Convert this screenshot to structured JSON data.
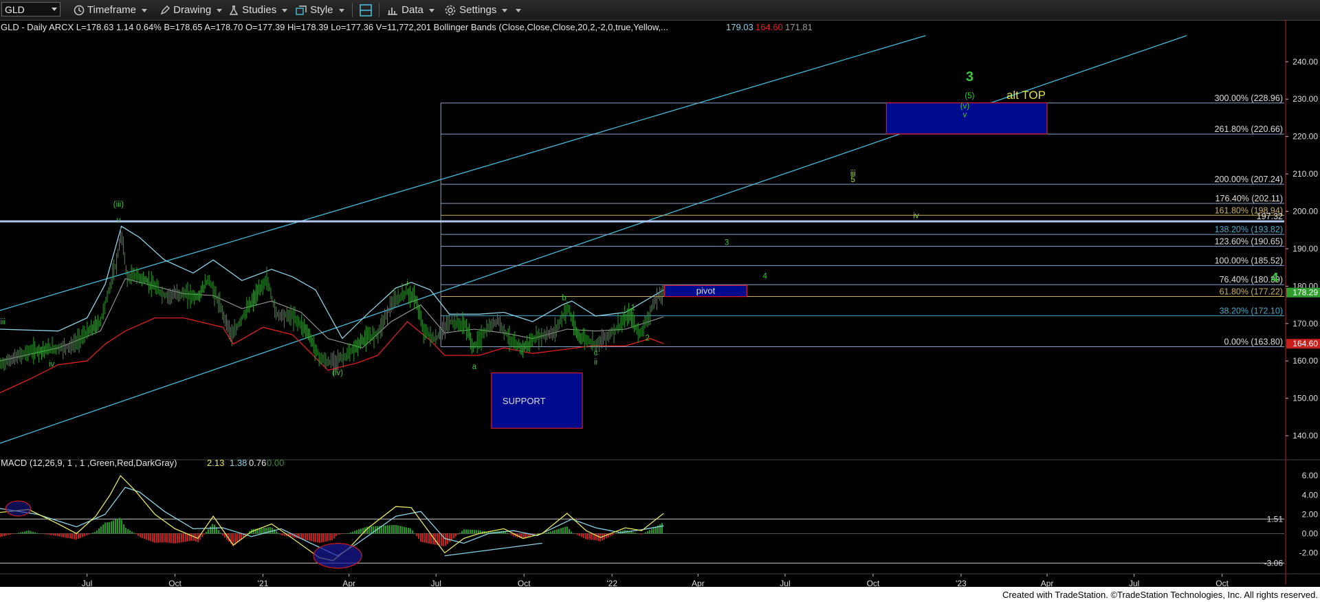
{
  "toolbar": {
    "symbol": "GLD",
    "timeframe": "Timeframe",
    "drawing": "Drawing",
    "studies": "Studies",
    "style": "Style",
    "data": "Data",
    "settings": "Settings"
  },
  "header": {
    "main": "GLD - Daily  ARCX  L=178.63  1.14  0.64%  B=178.65  A=178.70  O=177.39  Hi=178.39  Lo=177.36  V=11,772,201  Bollinger Bands (Close,Close,Close,20,2,-2,0,true,Yellow,...",
    "bb_upper": "179.03",
    "bb_lower": "164.60",
    "bb_mid": "171.81",
    "macd": "MACD (12,26,9, 1 , 1 ,Green,Red,DarkGray)",
    "macd_v1": "2.13",
    "macd_v2": "1.38",
    "macd_v3": "0.76",
    "macd_v4": "0.00"
  },
  "footer": "Created with TradeStation. ©TradeStation Technologies, Inc. All rights reserved.",
  "colors": {
    "price_bars": "#2e9e2e",
    "bb_upper": "#8fd4e8",
    "bb_lower": "#e02020",
    "bb_mid": "#9a9a9a",
    "channel": "#48bcd8",
    "fib": "#8aa2c8",
    "box": "#000a8c",
    "box_border": "#d81c2c",
    "wave": "#3cc83c",
    "wave_yellow": "#e0e040",
    "macd_line": "#e8e860",
    "signal_line": "#8fd4e8"
  },
  "chart_data": [
    {
      "type": "line",
      "title": "GLD - Daily",
      "x_ticks": [
        "Jul",
        "Oct",
        "'21",
        "Apr",
        "Jul",
        "Oct",
        "'22",
        "Apr",
        "Jul",
        "Oct",
        "'23",
        "Apr",
        "Jul",
        "Oct"
      ],
      "y_ticks": [
        140,
        150,
        160,
        170,
        180,
        190,
        200,
        210,
        220,
        230,
        240
      ],
      "ylim": [
        134.5,
        247.5
      ],
      "last_price": "178.29",
      "lower_band_value": "164.60",
      "price": [
        [
          "2020-04-01",
          159.0
        ],
        [
          "2020-05-01",
          162.5
        ],
        [
          "2020-06-01",
          163.5
        ],
        [
          "2020-06-15",
          164.0
        ],
        [
          "2020-07-01",
          167.5
        ],
        [
          "2020-07-15",
          170.5
        ],
        [
          "2020-07-25",
          180.0
        ],
        [
          "2020-08-01",
          186.5
        ],
        [
          "2020-08-06",
          194.5
        ],
        [
          "2020-08-12",
          182.0
        ],
        [
          "2020-08-20",
          183.0
        ],
        [
          "2020-09-01",
          181.5
        ],
        [
          "2020-09-20",
          177.5
        ],
        [
          "2020-10-10",
          178.0
        ],
        [
          "2020-10-25",
          177.0
        ],
        [
          "2020-11-05",
          182.0
        ],
        [
          "2020-11-15",
          176.0
        ],
        [
          "2020-11-30",
          166.5
        ],
        [
          "2020-12-10",
          171.5
        ],
        [
          "2021-01-05",
          182.0
        ],
        [
          "2021-01-15",
          172.5
        ],
        [
          "2021-02-01",
          172.0
        ],
        [
          "2021-02-15",
          168.5
        ],
        [
          "2021-03-01",
          161.0
        ],
        [
          "2021-03-10",
          159.5
        ],
        [
          "2021-03-31",
          161.5
        ],
        [
          "2021-04-15",
          165.5
        ],
        [
          "2021-05-01",
          167.5
        ],
        [
          "2021-05-15",
          175.0
        ],
        [
          "2021-05-31",
          178.5
        ],
        [
          "2021-06-10",
          176.5
        ],
        [
          "2021-06-17",
          168.5
        ],
        [
          "2021-06-30",
          165.5
        ],
        [
          "2021-07-15",
          170.5
        ],
        [
          "2021-08-01",
          169.5
        ],
        [
          "2021-08-09",
          163.5
        ],
        [
          "2021-08-20",
          167.5
        ],
        [
          "2021-09-03",
          171.0
        ],
        [
          "2021-09-20",
          164.5
        ],
        [
          "2021-09-30",
          163.5
        ],
        [
          "2021-10-15",
          166.5
        ],
        [
          "2021-11-01",
          167.5
        ],
        [
          "2021-11-16",
          174.5
        ],
        [
          "2021-11-25",
          167.0
        ],
        [
          "2021-12-15",
          164.5
        ],
        [
          "2022-01-03",
          168.0
        ],
        [
          "2022-01-20",
          172.5
        ],
        [
          "2022-01-28",
          167.5
        ],
        [
          "2022-02-01",
          168.0
        ],
        [
          "2022-02-11",
          173.5
        ],
        [
          "2022-02-17",
          177.0
        ],
        [
          "2022-02-24",
          178.3
        ]
      ],
      "bb_upper": [
        [
          "2020-04-01",
          168.5
        ],
        [
          "2020-06-01",
          168.0
        ],
        [
          "2020-07-01",
          171.5
        ],
        [
          "2020-07-20",
          180.5
        ],
        [
          "2020-08-06",
          196.0
        ],
        [
          "2020-08-25",
          193.0
        ],
        [
          "2020-09-20",
          187.0
        ],
        [
          "2020-10-20",
          183.5
        ],
        [
          "2020-11-10",
          187.0
        ],
        [
          "2020-12-10",
          181.5
        ],
        [
          "2021-01-10",
          184.5
        ],
        [
          "2021-02-01",
          182.5
        ],
        [
          "2021-02-25",
          179.0
        ],
        [
          "2021-03-25",
          166.0
        ],
        [
          "2021-04-20",
          172.5
        ],
        [
          "2021-05-20",
          179.5
        ],
        [
          "2021-06-05",
          181.0
        ],
        [
          "2021-06-25",
          179.0
        ],
        [
          "2021-07-15",
          172.5
        ],
        [
          "2021-08-15",
          172.5
        ],
        [
          "2021-09-10",
          173.0
        ],
        [
          "2021-10-10",
          170.5
        ],
        [
          "2021-11-10",
          175.0
        ],
        [
          "2021-11-20",
          176.0
        ],
        [
          "2021-12-15",
          172.0
        ],
        [
          "2022-01-15",
          173.0
        ],
        [
          "2022-02-24",
          179.0
        ]
      ],
      "bb_lower": [
        [
          "2020-04-01",
          151.5
        ],
        [
          "2020-05-01",
          155.0
        ],
        [
          "2020-06-01",
          159.0
        ],
        [
          "2020-07-01",
          160.0
        ],
        [
          "2020-07-20",
          164.5
        ],
        [
          "2020-08-10",
          168.0
        ],
        [
          "2020-09-10",
          171.5
        ],
        [
          "2020-10-10",
          171.5
        ],
        [
          "2020-11-20",
          169.0
        ],
        [
          "2020-12-01",
          164.5
        ],
        [
          "2021-01-01",
          169.0
        ],
        [
          "2021-02-01",
          167.0
        ],
        [
          "2021-03-10",
          157.5
        ],
        [
          "2021-04-10",
          159.5
        ],
        [
          "2021-05-01",
          161.5
        ],
        [
          "2021-06-01",
          170.5
        ],
        [
          "2021-06-25",
          165.5
        ],
        [
          "2021-07-10",
          161.5
        ],
        [
          "2021-08-15",
          161.5
        ],
        [
          "2021-09-10",
          163.5
        ],
        [
          "2021-10-10",
          162.0
        ],
        [
          "2021-11-10",
          163.0
        ],
        [
          "2021-12-10",
          164.0
        ],
        [
          "2022-01-15",
          164.0
        ],
        [
          "2022-02-10",
          166.0
        ],
        [
          "2022-02-24",
          164.6
        ]
      ],
      "bb_mid": [
        [
          "2020-04-01",
          160.0
        ],
        [
          "2020-06-01",
          163.5
        ],
        [
          "2020-07-15",
          168.0
        ],
        [
          "2020-08-10",
          182.0
        ],
        [
          "2020-09-10",
          180.0
        ],
        [
          "2020-10-10",
          178.0
        ],
        [
          "2020-11-10",
          177.5
        ],
        [
          "2020-12-10",
          174.0
        ],
        [
          "2021-01-10",
          176.0
        ],
        [
          "2021-02-10",
          173.0
        ],
        [
          "2021-03-10",
          166.0
        ],
        [
          "2021-04-15",
          163.5
        ],
        [
          "2021-05-15",
          170.5
        ],
        [
          "2021-06-15",
          175.0
        ],
        [
          "2021-07-10",
          167.5
        ],
        [
          "2021-08-10",
          168.5
        ],
        [
          "2021-09-10",
          167.5
        ],
        [
          "2021-10-10",
          166.0
        ],
        [
          "2021-11-15",
          168.5
        ],
        [
          "2021-12-15",
          168.0
        ],
        [
          "2022-01-15",
          168.5
        ],
        [
          "2022-02-24",
          171.8
        ]
      ],
      "channel_lines": [
        {
          "from": [
            "2020-04-01",
            173.5
          ],
          "to": [
            "2022-11-25",
            247.0
          ]
        },
        {
          "from": [
            "2020-04-01",
            138.0
          ],
          "to": [
            "2023-08-25",
            247.0
          ]
        }
      ],
      "fib_anchor_date": "2021-07-06",
      "fib_levels": [
        {
          "label": "300.00% (228.96)",
          "value": 228.96
        },
        {
          "label": "261.80% (220.66)",
          "value": 220.66
        },
        {
          "label": "200.00% (207.24)",
          "value": 207.24
        },
        {
          "label": "176.40% (202.11)",
          "value": 202.11
        },
        {
          "label": "161.80% (198.94)",
          "value": 198.94
        },
        {
          "label": "138.20% (193.82)",
          "value": 193.82
        },
        {
          "label": "123.60% (190.65)",
          "value": 190.65
        },
        {
          "label": "100.00% (185.52)",
          "value": 185.52
        },
        {
          "label": "76.40% (180.39)",
          "value": 180.39
        },
        {
          "label": "61.80% (177.22)",
          "value": 177.22
        },
        {
          "label": "38.20% (172.10)",
          "value": 172.1
        },
        {
          "label": "0.00% (163.80)",
          "value": 163.8
        }
      ],
      "resistance": {
        "value": 197.32,
        "label": "197.32"
      },
      "boxes": [
        {
          "label": "pivot",
          "x0": "2022-02-25",
          "x1": "2022-05-22",
          "y0": 177.2,
          "y1": 180.2
        },
        {
          "label": "SUPPORT",
          "x0": "2021-08-28",
          "x1": "2021-12-01",
          "y0": 142.0,
          "y1": 156.8
        },
        {
          "label": "",
          "x0": "2022-10-15",
          "x1": "2023-04-01",
          "y0": 220.7,
          "y1": 229.0
        }
      ],
      "wave_labels": [
        {
          "text": "iii",
          "x": "2020-04-04",
          "y": 169.8
        },
        {
          "text": "iv",
          "x": "2020-05-25",
          "y": 158.5
        },
        {
          "text": "(iii)",
          "x": "2020-08-03",
          "y": 201.2
        },
        {
          "text": "v",
          "x": "2020-08-03",
          "y": 197.0
        },
        {
          "text": "(iv)",
          "x": "2021-03-20",
          "y": 156.2
        },
        {
          "text": "i",
          "x": "2021-06-01",
          "y": 180.2
        },
        {
          "text": "a",
          "x": "2021-08-10",
          "y": 157.8
        },
        {
          "text": "b",
          "x": "2021-11-12",
          "y": 176.2
        },
        {
          "text": "c",
          "x": "2021-12-15",
          "y": 161.5
        },
        {
          "text": "ii",
          "x": "2021-12-15",
          "y": 159.0
        },
        {
          "text": "1",
          "x": "2022-01-23",
          "y": 173.5
        },
        {
          "text": "2",
          "x": "2022-02-07",
          "y": 165.5
        },
        {
          "text": "3",
          "x": "2022-05-01",
          "y": 191.0
        },
        {
          "text": "4",
          "x": "2022-06-10",
          "y": 182.0
        },
        {
          "text": "iii",
          "x": "2022-09-10",
          "y": 209.5
        },
        {
          "text": "5",
          "x": "2022-09-10",
          "y": 207.8
        },
        {
          "text": "iv",
          "x": "2022-11-15",
          "y": 198.2
        },
        {
          "text": "3",
          "x": "2023-01-10",
          "y": 234.8
        },
        {
          "text": "(5)",
          "x": "2023-01-10",
          "y": 230.2
        },
        {
          "text": "(v)",
          "x": "2023-01-05",
          "y": 227.5
        },
        {
          "text": "v",
          "x": "2023-01-05",
          "y": 225.2
        },
        {
          "text": "alt TOP",
          "x": "2023-03-10",
          "y": 230.0
        },
        {
          "text": "4",
          "x": "2023-11-25",
          "y": 181.0
        }
      ]
    },
    {
      "type": "bar",
      "title": "MACD (12,26,9, 1 , 1 ,Green,Red,DarkGray)",
      "y_ticks": [
        -2.0,
        0.0,
        2.0,
        4.0,
        6.0
      ],
      "ylim": [
        -4.1,
        6.8
      ],
      "ref_lines": [
        1.51,
        -3.06
      ],
      "macd": [
        [
          "2020-04-01",
          2.2
        ],
        [
          "2020-05-01",
          2.5
        ],
        [
          "2020-06-01",
          1.0
        ],
        [
          "2020-06-20",
          0.0
        ],
        [
          "2020-07-10",
          1.8
        ],
        [
          "2020-07-25",
          4.0
        ],
        [
          "2020-08-05",
          6.0
        ],
        [
          "2020-08-20",
          4.5
        ],
        [
          "2020-09-10",
          2.0
        ],
        [
          "2020-10-01",
          0.5
        ],
        [
          "2020-10-25",
          -0.5
        ],
        [
          "2020-11-10",
          1.8
        ],
        [
          "2020-12-01",
          -1.2
        ],
        [
          "2020-12-20",
          0.2
        ],
        [
          "2021-01-10",
          1.0
        ],
        [
          "2021-02-01",
          -0.5
        ],
        [
          "2021-03-01",
          -2.5
        ],
        [
          "2021-03-15",
          -2.8
        ],
        [
          "2021-04-01",
          -1.5
        ],
        [
          "2021-04-20",
          0.5
        ],
        [
          "2021-05-20",
          2.8
        ],
        [
          "2021-06-05",
          2.7
        ],
        [
          "2021-06-25",
          0.0
        ],
        [
          "2021-07-10",
          -2.0
        ],
        [
          "2021-07-30",
          -0.5
        ],
        [
          "2021-08-15",
          0.0
        ],
        [
          "2021-09-10",
          0.5
        ],
        [
          "2021-09-30",
          -0.5
        ],
        [
          "2021-10-20",
          0.0
        ],
        [
          "2021-11-15",
          2.1
        ],
        [
          "2021-12-05",
          0.3
        ],
        [
          "2021-12-20",
          -0.4
        ],
        [
          "2022-01-15",
          0.6
        ],
        [
          "2022-02-01",
          0.3
        ],
        [
          "2022-02-24",
          2.1
        ]
      ],
      "signal": [
        [
          "2020-04-01",
          2.6
        ],
        [
          "2020-05-10",
          2.0
        ],
        [
          "2020-06-20",
          0.7
        ],
        [
          "2020-07-20",
          2.0
        ],
        [
          "2020-08-10",
          4.8
        ],
        [
          "2020-08-25",
          4.3
        ],
        [
          "2020-09-20",
          2.3
        ],
        [
          "2020-10-20",
          0.5
        ],
        [
          "2020-11-20",
          0.6
        ],
        [
          "2020-12-20",
          -0.3
        ],
        [
          "2021-01-20",
          0.5
        ],
        [
          "2021-02-20",
          -1.0
        ],
        [
          "2021-03-20",
          -2.3
        ],
        [
          "2021-04-10",
          -1.0
        ],
        [
          "2021-05-20",
          1.8
        ],
        [
          "2021-06-15",
          2.3
        ],
        [
          "2021-07-10",
          -0.5
        ],
        [
          "2021-07-30",
          -1.0
        ],
        [
          "2021-08-25",
          0.0
        ],
        [
          "2021-09-20",
          0.3
        ],
        [
          "2021-10-15",
          -0.2
        ],
        [
          "2021-11-20",
          1.5
        ],
        [
          "2021-12-15",
          0.6
        ],
        [
          "2022-01-10",
          0.1
        ],
        [
          "2022-02-01",
          0.4
        ],
        [
          "2022-02-24",
          0.8
        ]
      ]
    }
  ]
}
